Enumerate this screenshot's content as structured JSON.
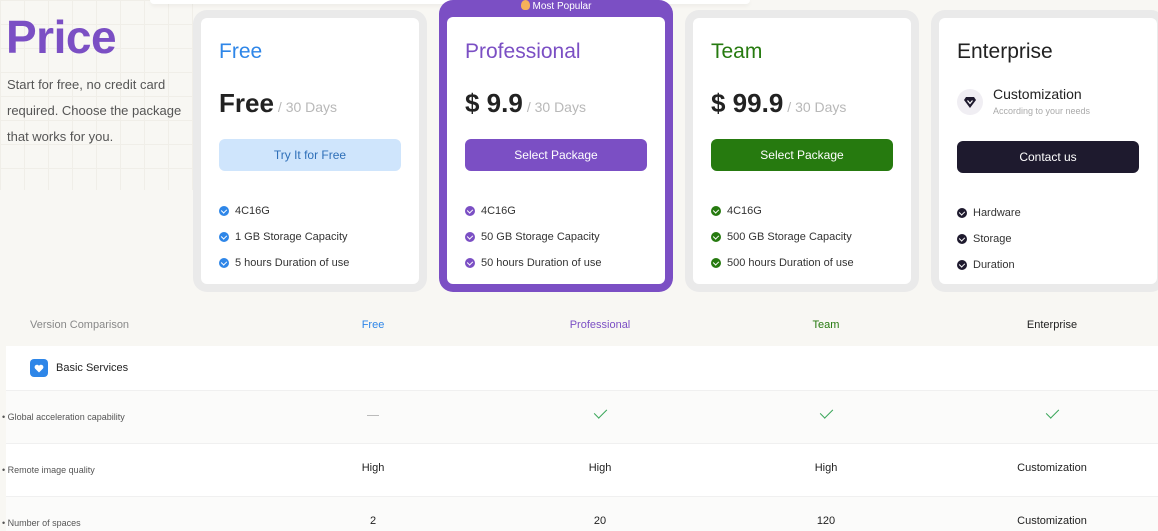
{
  "hero": {
    "title": "Price",
    "description": "Start for free, no credit card required. Choose the package that works for you."
  },
  "badge": {
    "popular": "Most Popular"
  },
  "plans": [
    {
      "name": "Free",
      "price": "Free",
      "period": "/ 30 Days",
      "button": "Try It for Free",
      "accent": "#2e86e8",
      "button_bg": "#cfe5fc",
      "button_fg": "#2e6fb8",
      "features": [
        "4C16G",
        "1 GB Storage Capacity",
        "5 hours Duration of use"
      ]
    },
    {
      "name": "Professional",
      "price": "$ 9.9",
      "period": "/ 30 Days",
      "button": "Select Package",
      "accent": "#7b4fc4",
      "button_bg": "#7b4fc4",
      "button_fg": "#ffffff",
      "features": [
        "4C16G",
        "50 GB Storage Capacity",
        "50 hours Duration of use"
      ]
    },
    {
      "name": "Team",
      "price": "$ 99.9",
      "period": "/ 30 Days",
      "button": "Select Package",
      "accent": "#267a0f",
      "button_bg": "#267a0f",
      "button_fg": "#ffffff",
      "features": [
        "4C16G",
        "500 GB Storage Capacity",
        "500 hours Duration of use"
      ]
    },
    {
      "name": "Enterprise",
      "custom_title": "Customization",
      "custom_sub": "According to your needs",
      "button": "Contact us",
      "accent": "#1e1a2e",
      "button_bg": "#1e1a2e",
      "button_fg": "#ffffff",
      "features": [
        "Hardware",
        "Storage",
        "Duration"
      ]
    }
  ],
  "comparison": {
    "label": "Version Comparison",
    "columns": [
      "Free",
      "Professional",
      "Team",
      "Enterprise"
    ],
    "section": "Basic Services",
    "rows": [
      {
        "label": "• Global acceleration capability",
        "values": [
          "—",
          "check",
          "check",
          "check"
        ]
      },
      {
        "label": "• Remote image quality",
        "values": [
          "High",
          "High",
          "High",
          "Customization"
        ]
      },
      {
        "label": "• Number of spaces",
        "values": [
          "2",
          "20",
          "120",
          "Customization"
        ]
      }
    ]
  }
}
